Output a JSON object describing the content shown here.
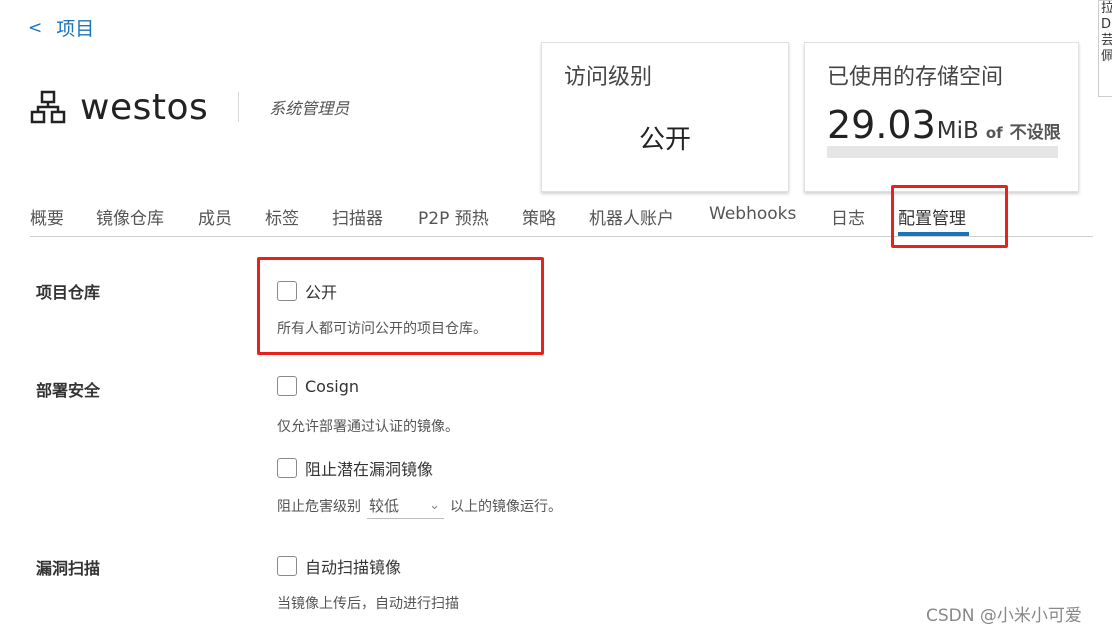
{
  "nav": {
    "back_label": "项目"
  },
  "project": {
    "name": "westos",
    "role": "系统管理员"
  },
  "summary": {
    "access_title": "访问级别",
    "access_value": "公开",
    "storage_title": "已使用的存储空间",
    "storage_used": "29.03",
    "storage_unit": "MiB",
    "storage_of": "of",
    "storage_limit": "不设限",
    "storage_fraction": 0
  },
  "edge_text": "拉\nD\n芸\n佩",
  "tabs": [
    {
      "label": "概要"
    },
    {
      "label": "镜像仓库"
    },
    {
      "label": "成员"
    },
    {
      "label": "标签"
    },
    {
      "label": "扫描器"
    },
    {
      "label": "P2P 预热"
    },
    {
      "label": "策略"
    },
    {
      "label": "机器人账户"
    },
    {
      "label": "Webhooks"
    },
    {
      "label": "日志"
    },
    {
      "label": "配置管理",
      "active": true
    }
  ],
  "config": {
    "repo": {
      "label": "项目仓库",
      "public_label": "公开",
      "public_checked": false,
      "public_help": "所有人都可访问公开的项目仓库。"
    },
    "security": {
      "label": "部署安全",
      "cosign_label": "Cosign",
      "cosign_checked": false,
      "cosign_help": "仅允许部署通过认证的镜像。",
      "prevent_label": "阻止潜在漏洞镜像",
      "prevent_checked": false,
      "severity_prefix": "阻止危害级别",
      "severity_value": "较低",
      "severity_suffix": "以上的镜像运行。"
    },
    "scan": {
      "label": "漏洞扫描",
      "auto_label": "自动扫描镜像",
      "auto_checked": false,
      "auto_help": "当镜像上传后，自动进行扫描"
    }
  },
  "watermark": "CSDN @小米小可爱",
  "colors": {
    "accent": "#1b74b8",
    "highlight": "#e8221b"
  }
}
